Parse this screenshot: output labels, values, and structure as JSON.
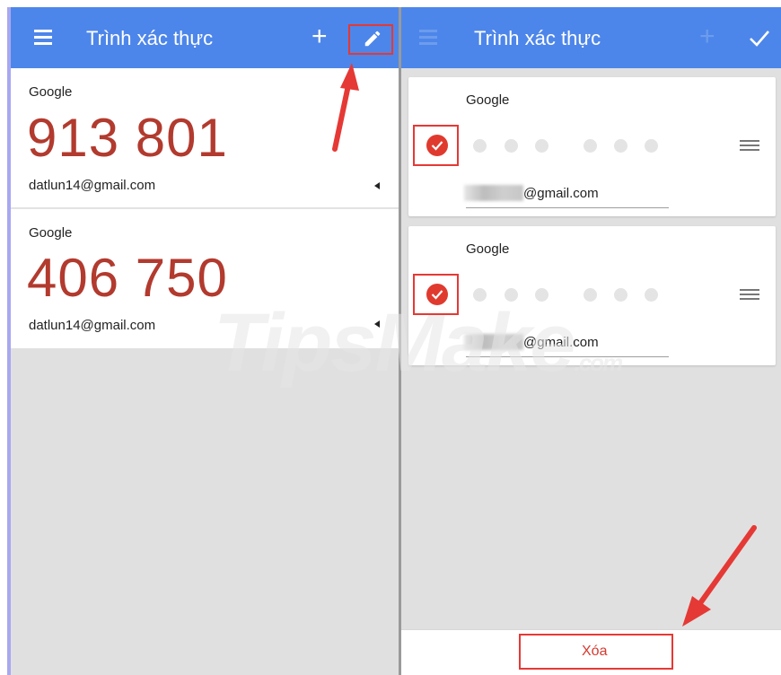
{
  "left_panel": {
    "title": "Trình xác thực",
    "accounts": [
      {
        "issuer": "Google",
        "code": "913 801",
        "account": "datlun14@gmail.com"
      },
      {
        "issuer": "Google",
        "code": "406 750",
        "account": "datlun14@gmail.com"
      }
    ]
  },
  "right_panel": {
    "title": "Trình xác thực",
    "accounts": [
      {
        "issuer": "Google",
        "email_suffix": "@gmail.com",
        "selected": true
      },
      {
        "issuer": "Google",
        "email_suffix": "@gmail.com",
        "selected": true
      }
    ],
    "delete_label": "Xóa"
  },
  "watermark": {
    "main": "TipsMake",
    "suffix": ".com"
  },
  "icons": {
    "menu": "menu-icon",
    "add": "plus-icon",
    "edit": "pencil-icon",
    "done": "checkmark-icon",
    "selected": "check-circle-icon",
    "reorder": "drag-handle-icon",
    "expand": "triangle-icon"
  },
  "colors": {
    "app_bar": "#4d86ea",
    "code": "#b23a2e",
    "check": "#e03a2f",
    "highlight": "#e53935",
    "delete_text": "#d53a30"
  }
}
